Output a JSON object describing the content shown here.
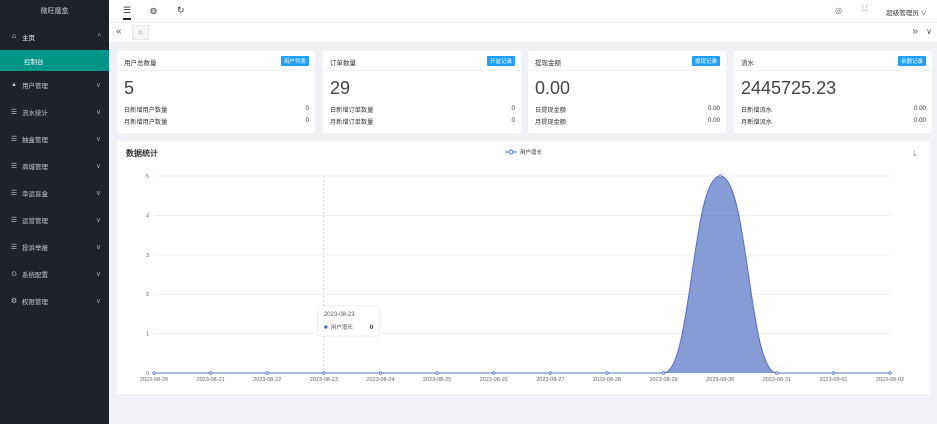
{
  "sidebar": {
    "logo": "微旺魔盒",
    "home_label": "主页",
    "active_sub": "控制台",
    "items": [
      {
        "label": "用户管理",
        "icon": "users-icon"
      },
      {
        "label": "流水统计",
        "icon": "list-icon"
      },
      {
        "label": "抽盒管理",
        "icon": "list-icon"
      },
      {
        "label": "商城管理",
        "icon": "list-icon"
      },
      {
        "label": "幸运盲盒",
        "icon": "list-icon"
      },
      {
        "label": "运营管理",
        "icon": "list-icon"
      },
      {
        "label": "投诉举报",
        "icon": "list-icon"
      },
      {
        "label": "系统配置",
        "icon": "settings-icon"
      },
      {
        "label": "权限管理",
        "icon": "gear-icon"
      }
    ]
  },
  "header": {
    "user": "超级管理员"
  },
  "cards": [
    {
      "title": "用户总数量",
      "badge": "用户列表",
      "value": "5",
      "rows": [
        {
          "label": "日新增用户数量",
          "value": "0"
        },
        {
          "label": "月新增用户数量",
          "value": "0"
        }
      ]
    },
    {
      "title": "订单数量",
      "badge": "开盒记录",
      "value": "29",
      "rows": [
        {
          "label": "日新增订单数量",
          "value": "0"
        },
        {
          "label": "月新增订单数量",
          "value": "0"
        }
      ]
    },
    {
      "title": "提现金额",
      "badge": "提现记录",
      "value": "0.00",
      "rows": [
        {
          "label": "日提现金额",
          "value": "0.00"
        },
        {
          "label": "月提现金额",
          "value": "0.00"
        }
      ]
    },
    {
      "title": "流水",
      "badge": "余额记录",
      "value": "2445725.23",
      "rows": [
        {
          "label": "日新增流水",
          "value": "0.00"
        },
        {
          "label": "月新增流水",
          "value": "0.00"
        }
      ]
    }
  ],
  "chart": {
    "title": "数据统计",
    "tooltip": {
      "date": "2023-08-23",
      "series": "用户增长",
      "value": "0"
    }
  },
  "chart_data": {
    "type": "area",
    "x": [
      "2023-08-20",
      "2023-08-21",
      "2023-08-22",
      "2023-08-23",
      "2023-08-24",
      "2023-08-25",
      "2023-08-26",
      "2023-08-27",
      "2023-08-28",
      "2023-08-29",
      "2023-08-30",
      "2023-08-31",
      "2023-09-01",
      "2023-09-02"
    ],
    "series": [
      {
        "name": "用户增长",
        "values": [
          0,
          0,
          0,
          0,
          0,
          0,
          0,
          0,
          0,
          0,
          5,
          0,
          0,
          0
        ]
      }
    ],
    "yticks": [
      0,
      1,
      2,
      3,
      4,
      5
    ],
    "ylim": [
      0,
      5
    ],
    "grid": true,
    "legend": "top-center",
    "color": "#5470c6"
  }
}
